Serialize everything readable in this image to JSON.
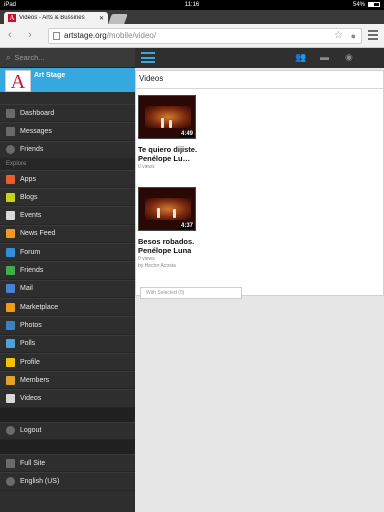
{
  "statusbar": {
    "device": "iPad",
    "time": "11:16",
    "battery": "54%",
    "battery_fraction": 0.54
  },
  "browser": {
    "tab_title": "Videos - Arts & Bussines",
    "tab_close": "✕",
    "url_host": "artstage.org",
    "url_path": "/mobile/video/"
  },
  "sidebar": {
    "search_placeholder": "Search...",
    "profile_name": "Art Stage",
    "profile_logo": "A",
    "main_items": [
      {
        "label": "Dashboard",
        "icon": "dashboard-icon"
      },
      {
        "label": "Messages",
        "icon": "messages-icon"
      },
      {
        "label": "Friends",
        "icon": "friends-icon"
      }
    ],
    "explore_header": "Explore",
    "explore_items": [
      {
        "label": "Apps",
        "icon": "apps-icon",
        "color": "#e85d2b"
      },
      {
        "label": "Blogs",
        "icon": "blogs-icon",
        "color": "#c8d11a"
      },
      {
        "label": "Events",
        "icon": "events-icon",
        "color": "#d8d8d8"
      },
      {
        "label": "News Feed",
        "icon": "rss-icon",
        "color": "#f39a1e"
      },
      {
        "label": "Forum",
        "icon": "forum-icon",
        "color": "#2f8fd8"
      },
      {
        "label": "Friends",
        "icon": "friends-icon",
        "color": "#3fae49"
      },
      {
        "label": "Mail",
        "icon": "mail-icon",
        "color": "#4a7fd6"
      },
      {
        "label": "Marketplace",
        "icon": "marketplace-icon",
        "color": "#f09a1a"
      },
      {
        "label": "Photos",
        "icon": "photos-icon",
        "color": "#3b82c4"
      },
      {
        "label": "Polls",
        "icon": "polls-icon",
        "color": "#4aa3df"
      },
      {
        "label": "Profile",
        "icon": "profile-icon",
        "color": "#f2c200"
      },
      {
        "label": "Members",
        "icon": "members-icon",
        "color": "#e2a12a"
      },
      {
        "label": "Videos",
        "icon": "videos-icon",
        "color": "#d8d8d8"
      }
    ],
    "logout": "Logout",
    "full_site": "Full Site",
    "language": "English (US)"
  },
  "main": {
    "section_title": "Videos",
    "videos": [
      {
        "title": "Te quiero dijiste. Penélope Lu…",
        "duration": "4:49",
        "views": "0 views",
        "author": ""
      },
      {
        "title": "Besos robados. Penélope Luna",
        "duration": "4:37",
        "views": "0 views",
        "author": "by Hector Acosta"
      }
    ],
    "with_selected": "With Selected (0)"
  }
}
